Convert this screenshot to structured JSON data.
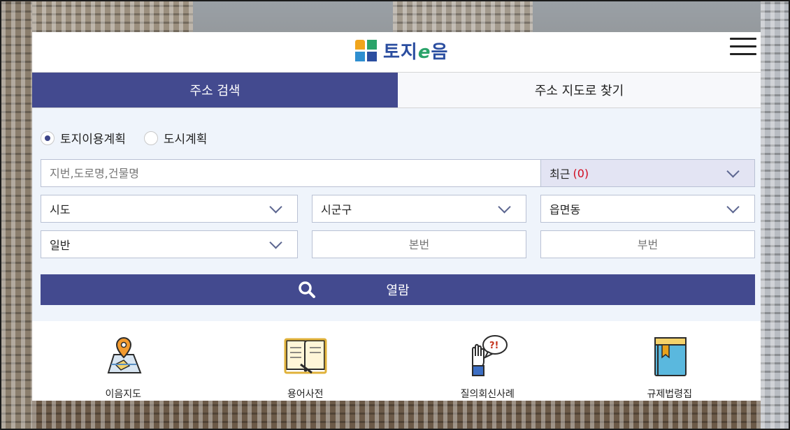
{
  "header": {
    "logo_text_1": "토지",
    "logo_text_e": "e",
    "logo_text_2": "음"
  },
  "tabs": [
    {
      "label": "주소 검색",
      "active": true
    },
    {
      "label": "주소 지도로 찾기",
      "active": false
    }
  ],
  "search": {
    "radio_options": [
      {
        "label": "토지이용계획",
        "checked": true
      },
      {
        "label": "도시계획",
        "checked": false
      }
    ],
    "keyword_placeholder": "지번,도로명,건물명",
    "recent_label": "최근",
    "recent_count": "(0)",
    "sido_value": "시도",
    "sigungu_value": "시군구",
    "eupmyeondong_value": "읍면동",
    "land_type_value": "일반",
    "main_number_placeholder": "본번",
    "sub_number_placeholder": "부번",
    "view_button_label": "열람"
  },
  "quick_links": [
    {
      "label": "이음지도",
      "icon": "map-pin-icon"
    },
    {
      "label": "용어사전",
      "icon": "open-book-icon"
    },
    {
      "label": "질의회신사례",
      "icon": "question-hand-icon"
    },
    {
      "label": "규제법령집",
      "icon": "law-book-icon"
    }
  ],
  "colors": {
    "primary": "#434a8f",
    "search_bg": "#eff4fb",
    "recent_bg": "#e3e4f3",
    "recent_count": "#d10b1f",
    "logo_blue": "#2b4ea0",
    "logo_green": "#2aa36a"
  }
}
